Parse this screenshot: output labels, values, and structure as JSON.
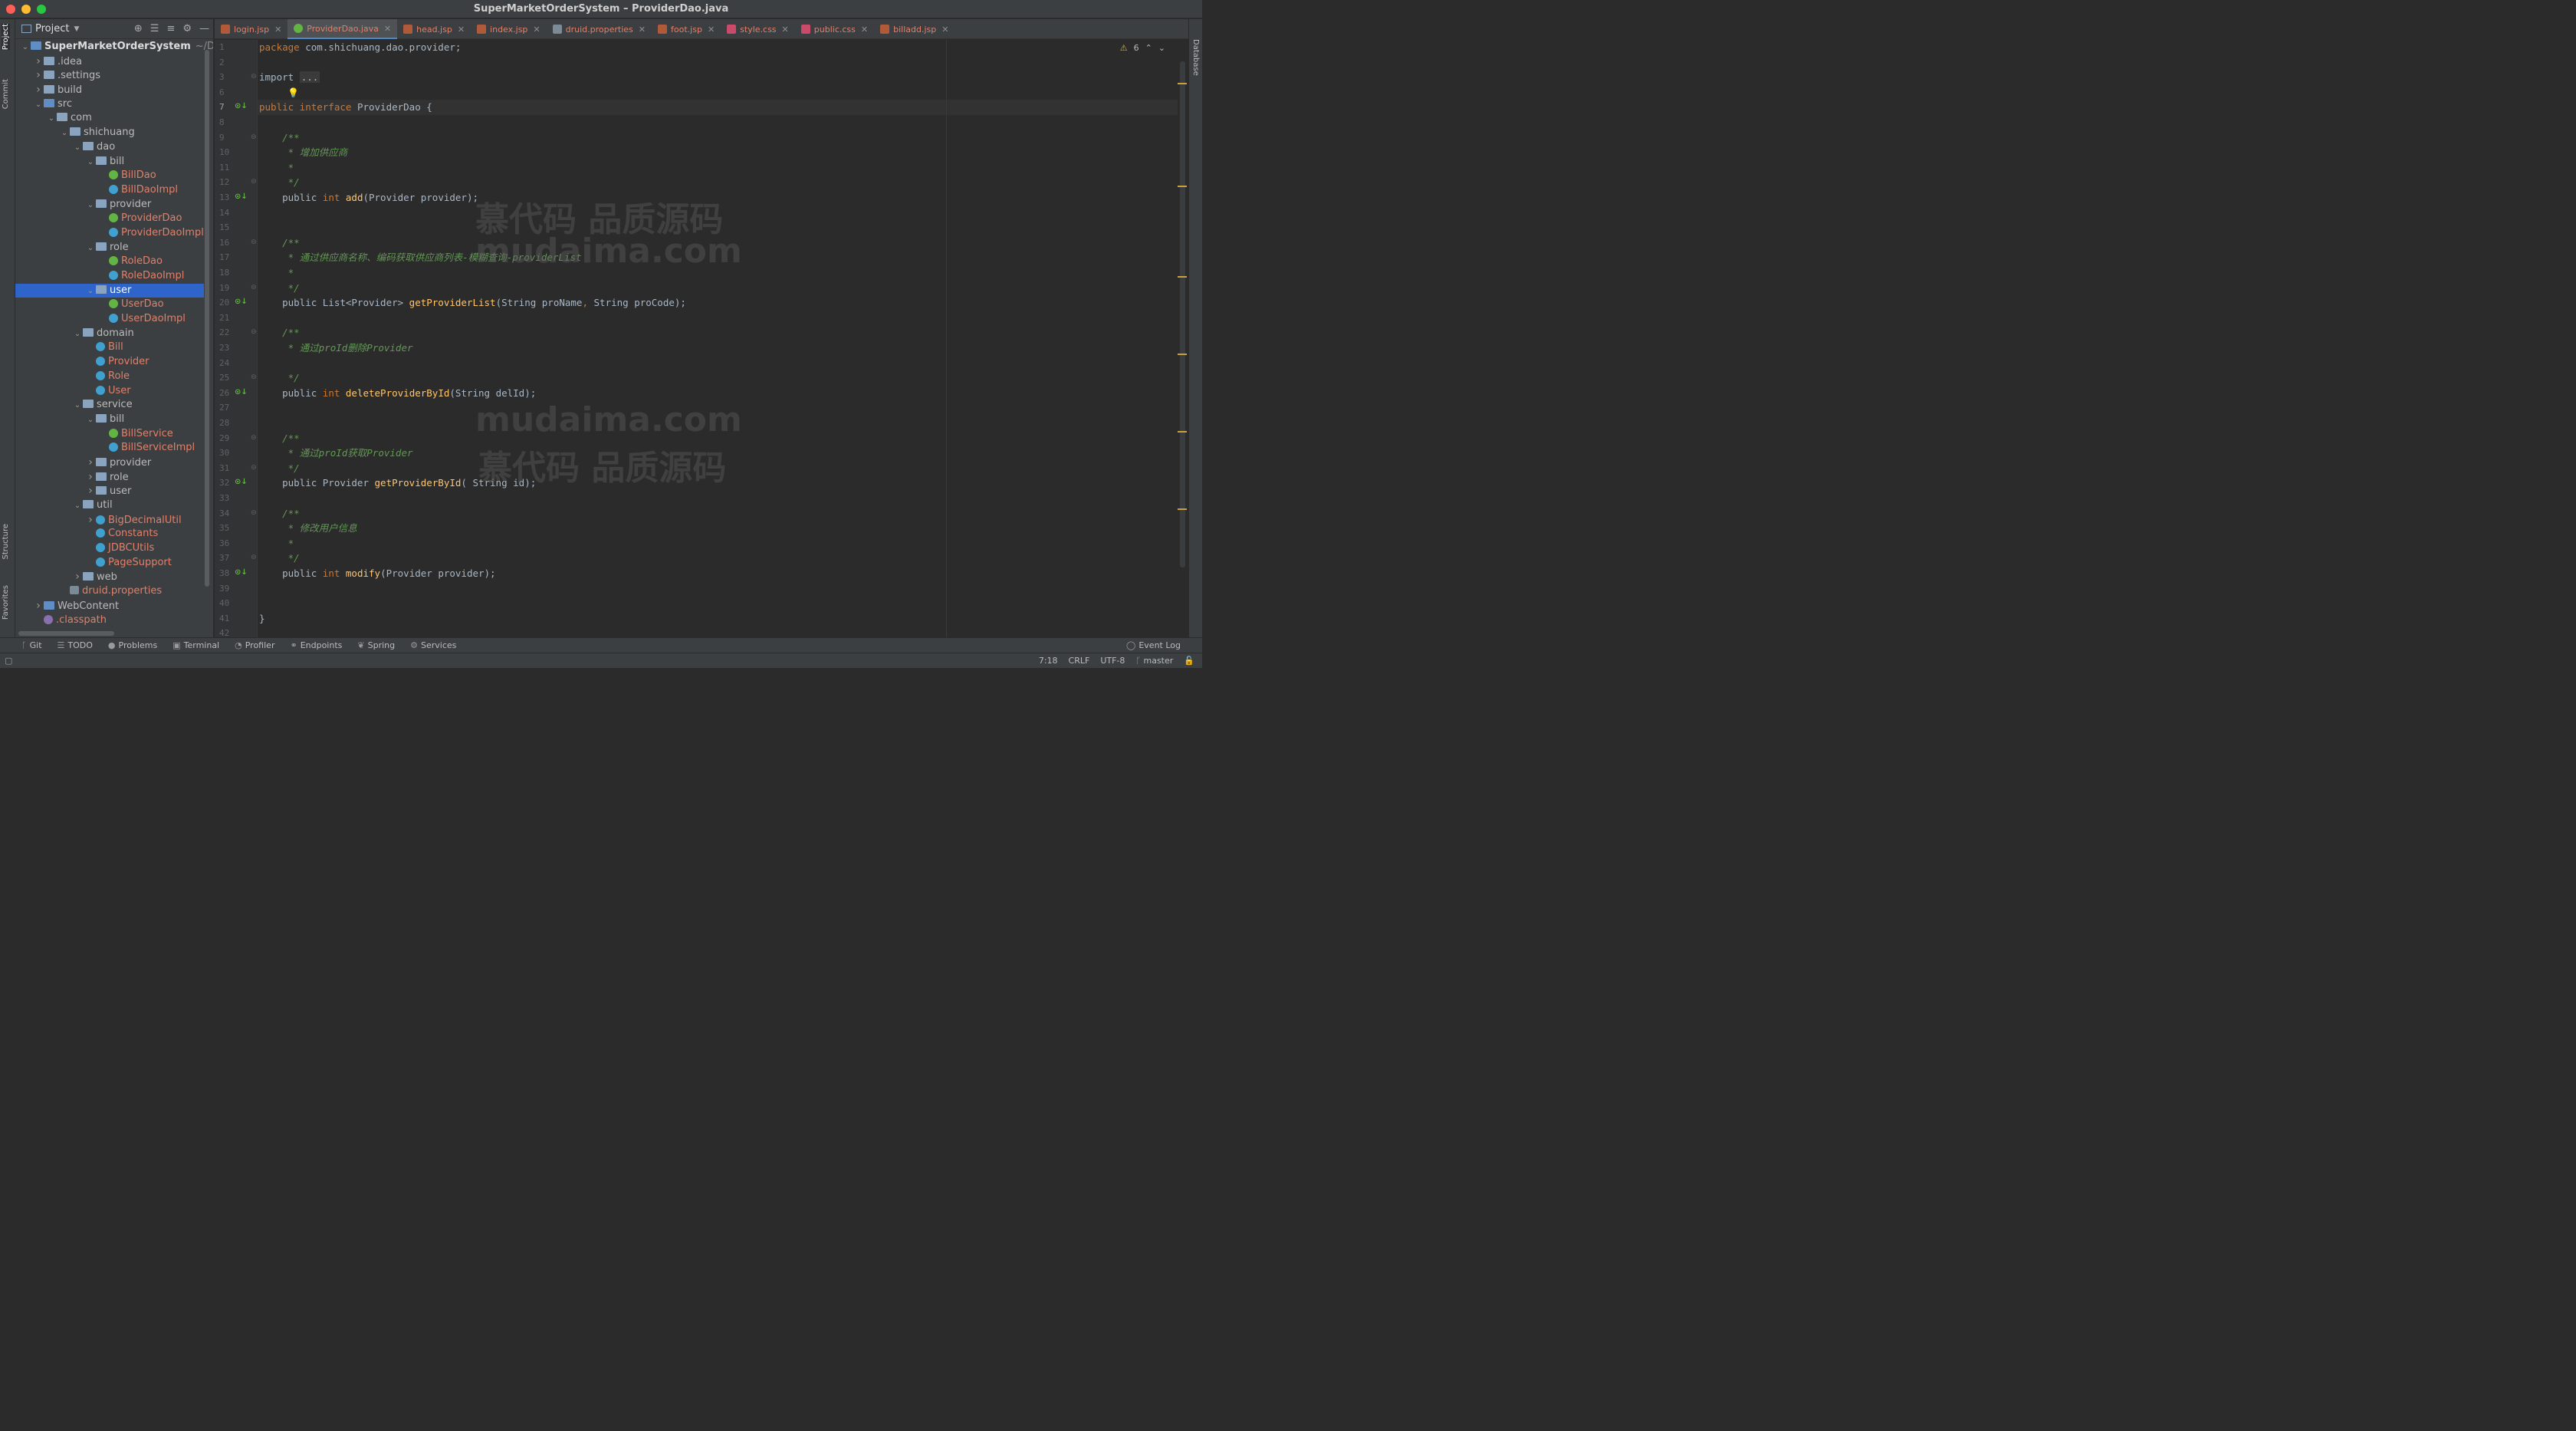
{
  "window": {
    "title": "SuperMarketOrderSystem – ProviderDao.java",
    "traffic_lights": [
      "#ff5f57",
      "#febc2e",
      "#28c840"
    ]
  },
  "left_strip": {
    "project": "Project",
    "commit": "Commit",
    "structure": "Structure",
    "favorites": "Favorites"
  },
  "right_strip": {
    "database": "Database"
  },
  "project_panel": {
    "title": "Project",
    "tree": [
      {
        "label": "SuperMarketOrderSystem",
        "suffix": "~/Dow",
        "depth": 0,
        "arrow": "open",
        "icon": "module",
        "style": "bold"
      },
      {
        "label": ".idea",
        "depth": 1,
        "arrow": "closed",
        "icon": "folder"
      },
      {
        "label": ".settings",
        "depth": 1,
        "arrow": "closed",
        "icon": "folder"
      },
      {
        "label": "build",
        "depth": 1,
        "arrow": "closed",
        "icon": "folder"
      },
      {
        "label": "src",
        "depth": 1,
        "arrow": "open",
        "icon": "folder-blue"
      },
      {
        "label": "com",
        "depth": 2,
        "arrow": "open",
        "icon": "folder"
      },
      {
        "label": "shichuang",
        "depth": 3,
        "arrow": "open",
        "icon": "folder"
      },
      {
        "label": "dao",
        "depth": 4,
        "arrow": "open",
        "icon": "folder"
      },
      {
        "label": "bill",
        "depth": 5,
        "arrow": "open",
        "icon": "folder"
      },
      {
        "label": "BillDao",
        "depth": 6,
        "icon": "interface",
        "style": "err"
      },
      {
        "label": "BillDaoImpl",
        "depth": 6,
        "icon": "class",
        "style": "err"
      },
      {
        "label": "provider",
        "depth": 5,
        "arrow": "open",
        "icon": "folder"
      },
      {
        "label": "ProviderDao",
        "depth": 6,
        "icon": "interface",
        "style": "err"
      },
      {
        "label": "ProviderDaoImpl",
        "depth": 6,
        "icon": "class",
        "style": "err"
      },
      {
        "label": "role",
        "depth": 5,
        "arrow": "open",
        "icon": "folder"
      },
      {
        "label": "RoleDao",
        "depth": 6,
        "icon": "interface",
        "style": "err"
      },
      {
        "label": "RoleDaoImpl",
        "depth": 6,
        "icon": "class",
        "style": "err"
      },
      {
        "label": "user",
        "depth": 5,
        "arrow": "open",
        "icon": "folder",
        "selected": true
      },
      {
        "label": "UserDao",
        "depth": 6,
        "icon": "interface",
        "style": "err"
      },
      {
        "label": "UserDaoImpl",
        "depth": 6,
        "icon": "class",
        "style": "err"
      },
      {
        "label": "domain",
        "depth": 4,
        "arrow": "open",
        "icon": "folder"
      },
      {
        "label": "Bill",
        "depth": 5,
        "icon": "class",
        "style": "err"
      },
      {
        "label": "Provider",
        "depth": 5,
        "icon": "class",
        "style": "err"
      },
      {
        "label": "Role",
        "depth": 5,
        "icon": "class",
        "style": "err"
      },
      {
        "label": "User",
        "depth": 5,
        "icon": "class",
        "style": "err"
      },
      {
        "label": "service",
        "depth": 4,
        "arrow": "open",
        "icon": "folder"
      },
      {
        "label": "bill",
        "depth": 5,
        "arrow": "open",
        "icon": "folder"
      },
      {
        "label": "BillService",
        "depth": 6,
        "icon": "interface",
        "style": "err"
      },
      {
        "label": "BillServiceImpl",
        "depth": 6,
        "icon": "class",
        "style": "err"
      },
      {
        "label": "provider",
        "depth": 5,
        "arrow": "closed",
        "icon": "folder"
      },
      {
        "label": "role",
        "depth": 5,
        "arrow": "closed",
        "icon": "folder"
      },
      {
        "label": "user",
        "depth": 5,
        "arrow": "closed",
        "icon": "folder"
      },
      {
        "label": "util",
        "depth": 4,
        "arrow": "open",
        "icon": "folder"
      },
      {
        "label": "BigDecimalUtil",
        "depth": 5,
        "arrow": "closed",
        "icon": "class",
        "style": "err"
      },
      {
        "label": "Constants",
        "depth": 5,
        "icon": "class",
        "style": "err"
      },
      {
        "label": "JDBCUtils",
        "depth": 5,
        "icon": "class",
        "style": "err"
      },
      {
        "label": "PageSupport",
        "depth": 5,
        "icon": "class",
        "style": "err"
      },
      {
        "label": "web",
        "depth": 4,
        "arrow": "closed",
        "icon": "folder"
      },
      {
        "label": "druid.properties",
        "depth": 3,
        "icon": "properties",
        "style": "err"
      },
      {
        "label": "WebContent",
        "depth": 1,
        "arrow": "closed",
        "icon": "folder-blue"
      },
      {
        "label": ".classpath",
        "depth": 1,
        "icon": "classpath",
        "style": "err"
      }
    ]
  },
  "tabs": [
    {
      "label": "login.jsp",
      "type": "jsp"
    },
    {
      "label": "ProviderDao.java",
      "type": "java",
      "active": true
    },
    {
      "label": "head.jsp",
      "type": "jsp"
    },
    {
      "label": "index.jsp",
      "type": "jsp"
    },
    {
      "label": "druid.properties",
      "type": "props"
    },
    {
      "label": "foot.jsp",
      "type": "jsp"
    },
    {
      "label": "style.css",
      "type": "css"
    },
    {
      "label": "public.css",
      "type": "css"
    },
    {
      "label": "billadd.jsp",
      "type": "jsp"
    }
  ],
  "editor": {
    "warnings_count": "6",
    "current_line": 7,
    "lines": [
      {
        "n": 1,
        "tokens": [
          [
            "kw",
            "package "
          ],
          [
            "",
            "com.shichuang.dao.provider;"
          ]
        ]
      },
      {
        "n": 2,
        "tokens": []
      },
      {
        "n": 3,
        "tokens": [
          [
            "",
            "import "
          ],
          [
            "fold",
            "..."
          ]
        ],
        "fold": true
      },
      {
        "n": 6,
        "tokens": []
      },
      {
        "n": 7,
        "tokens": [
          [
            "kw",
            "public interface "
          ],
          [
            "",
            "ProviderDao {"
          ]
        ],
        "gutter": "impl"
      },
      {
        "n": 8,
        "tokens": []
      },
      {
        "n": 9,
        "tokens": [
          [
            "cm",
            "    /**"
          ]
        ],
        "fold": true
      },
      {
        "n": 10,
        "tokens": [
          [
            "cm",
            "     * 增加供应商"
          ]
        ]
      },
      {
        "n": 11,
        "tokens": [
          [
            "cm",
            "     *"
          ]
        ]
      },
      {
        "n": 12,
        "tokens": [
          [
            "cm",
            "     */"
          ]
        ],
        "fold": true
      },
      {
        "n": 13,
        "tokens": [
          [
            "",
            "    public "
          ],
          [
            "kw",
            "int "
          ],
          [
            "fn",
            "add"
          ],
          [
            "",
            "(Provider provider);"
          ]
        ],
        "gutter": "impl"
      },
      {
        "n": 14,
        "tokens": []
      },
      {
        "n": 15,
        "tokens": []
      },
      {
        "n": 16,
        "tokens": [
          [
            "cm",
            "    /**"
          ]
        ],
        "fold": true
      },
      {
        "n": 17,
        "tokens": [
          [
            "cm",
            "     * 通过供应商名称、编码获取供应商列表-模糊查询-providerList"
          ]
        ]
      },
      {
        "n": 18,
        "tokens": [
          [
            "cm",
            "     *"
          ]
        ]
      },
      {
        "n": 19,
        "tokens": [
          [
            "cm",
            "     */"
          ]
        ],
        "fold": true
      },
      {
        "n": 20,
        "tokens": [
          [
            "",
            "    public List<Provider> "
          ],
          [
            "fn",
            "getProviderList"
          ],
          [
            "",
            "(String proName"
          ],
          [
            "kw",
            ", "
          ],
          [
            "",
            "String proCode);"
          ]
        ],
        "gutter": "impl"
      },
      {
        "n": 21,
        "tokens": []
      },
      {
        "n": 22,
        "tokens": [
          [
            "cm",
            "    /**"
          ]
        ],
        "fold": true
      },
      {
        "n": 23,
        "tokens": [
          [
            "cm",
            "     * 通过proId删除Provider"
          ]
        ]
      },
      {
        "n": 24,
        "tokens": []
      },
      {
        "n": 25,
        "tokens": [
          [
            "cm",
            "     */"
          ]
        ],
        "fold": true
      },
      {
        "n": 26,
        "tokens": [
          [
            "",
            "    public "
          ],
          [
            "kw",
            "int "
          ],
          [
            "fn",
            "deleteProviderById"
          ],
          [
            "",
            "(String delId);"
          ]
        ],
        "gutter": "impl"
      },
      {
        "n": 27,
        "tokens": []
      },
      {
        "n": 28,
        "tokens": []
      },
      {
        "n": 29,
        "tokens": [
          [
            "cm",
            "    /**"
          ]
        ],
        "fold": true
      },
      {
        "n": 30,
        "tokens": [
          [
            "cm",
            "     * 通过proId获取Provider"
          ]
        ]
      },
      {
        "n": 31,
        "tokens": [
          [
            "cm",
            "     */"
          ]
        ],
        "fold": true
      },
      {
        "n": 32,
        "tokens": [
          [
            "",
            "    public Provider "
          ],
          [
            "fn",
            "getProviderById"
          ],
          [
            "",
            "( String id);"
          ]
        ],
        "gutter": "impl"
      },
      {
        "n": 33,
        "tokens": []
      },
      {
        "n": 34,
        "tokens": [
          [
            "cm",
            "    /**"
          ]
        ],
        "fold": true
      },
      {
        "n": 35,
        "tokens": [
          [
            "cm",
            "     * 修改用户信息"
          ]
        ]
      },
      {
        "n": 36,
        "tokens": [
          [
            "cm",
            "     *"
          ]
        ]
      },
      {
        "n": 37,
        "tokens": [
          [
            "cm",
            "     */"
          ]
        ],
        "fold": true
      },
      {
        "n": 38,
        "tokens": [
          [
            "",
            "    public "
          ],
          [
            "kw",
            "int "
          ],
          [
            "fn",
            "modify"
          ],
          [
            "",
            "(Provider provider);"
          ]
        ],
        "gutter": "impl"
      },
      {
        "n": 39,
        "tokens": []
      },
      {
        "n": 40,
        "tokens": []
      },
      {
        "n": 41,
        "tokens": [
          [
            "",
            "}"
          ]
        ]
      },
      {
        "n": 42,
        "tokens": []
      }
    ]
  },
  "watermarks": {
    "top_cn": "慕代码 品质源码",
    "top_en": "mudaima.com",
    "bottom_en": "mudaima.com",
    "bottom_cn": "慕代码 品质源码"
  },
  "tool_windows": [
    {
      "label": "Git",
      "icon": "git-icon",
      "glyph": "ᚴ"
    },
    {
      "label": "TODO",
      "icon": "todo-icon",
      "glyph": "☰"
    },
    {
      "label": "Problems",
      "icon": "problems-icon",
      "glyph": "●"
    },
    {
      "label": "Terminal",
      "icon": "terminal-icon",
      "glyph": "▣"
    },
    {
      "label": "Profiler",
      "icon": "profiler-icon",
      "glyph": "◔"
    },
    {
      "label": "Endpoints",
      "icon": "endpoints-icon",
      "glyph": "⚭"
    },
    {
      "label": "Spring",
      "icon": "spring-icon",
      "glyph": "❦"
    },
    {
      "label": "Services",
      "icon": "services-icon",
      "glyph": "⚙"
    }
  ],
  "event_log": "Event Log",
  "status": {
    "position": "7:18",
    "line_sep": "CRLF",
    "encoding": "UTF-8",
    "branch": "master"
  }
}
